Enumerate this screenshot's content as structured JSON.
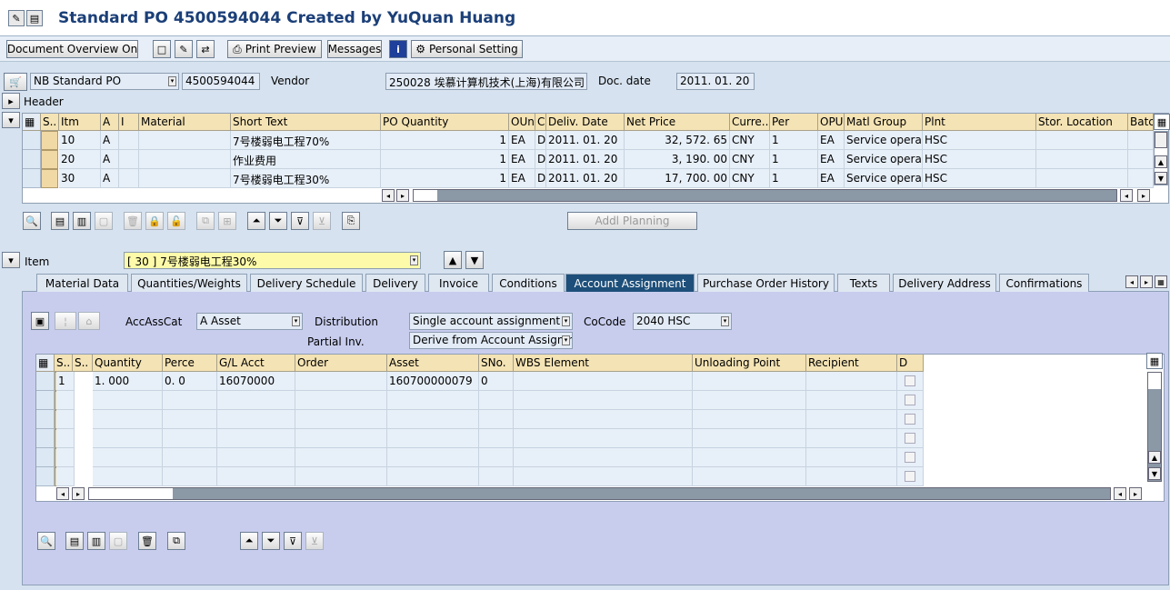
{
  "window": {
    "title": "Standard PO 4500594044 Created by YuQuan Huang"
  },
  "toolbar": {
    "doc_overview": "Document Overview On",
    "print_preview": "Print Preview",
    "messages": "Messages",
    "personal_setting": "Personal Setting"
  },
  "header": {
    "doc_type": "NB Standard PO",
    "po_number": "4500594044",
    "vendor_label": "Vendor",
    "vendor_value": "250028 埃慕计算机技术(上海)有限公司",
    "docdate_label": "Doc. date",
    "docdate_value": "2011. 01. 20",
    "header_label": "Header"
  },
  "items_table": {
    "columns": [
      "S..",
      "Itm",
      "A",
      "I",
      "Material",
      "Short Text",
      "PO Quantity",
      "OUn",
      "C",
      "Deliv. Date",
      "Net Price",
      "Curre...",
      "Per",
      "OPU",
      "Matl Group",
      "Plnt",
      "Stor. Location",
      "Batch"
    ],
    "rows": [
      {
        "itm": "10",
        "a": "A",
        "short": "7号楼弱电工程70%",
        "qty": "1",
        "oun": "EA",
        "c": "D",
        "date": "2011. 01. 20",
        "price": "32, 572. 65",
        "cur": "CNY",
        "per": "1",
        "opu": "EA",
        "matl": "Service operatio",
        "plnt": "HSC"
      },
      {
        "itm": "20",
        "a": "A",
        "short": "作业费用",
        "qty": "1",
        "oun": "EA",
        "c": "D",
        "date": "2011. 01. 20",
        "price": "3, 190. 00",
        "cur": "CNY",
        "per": "1",
        "opu": "EA",
        "matl": "Service operatio",
        "plnt": "HSC"
      },
      {
        "itm": "30",
        "a": "A",
        "short": "7号楼弱电工程30%",
        "qty": "1",
        "oun": "EA",
        "c": "D",
        "date": "2011. 01. 20",
        "price": "17, 700. 00",
        "cur": "CNY",
        "per": "1",
        "opu": "EA",
        "matl": "Service operatio",
        "plnt": "HSC"
      }
    ]
  },
  "addl_planning": "Addl Planning",
  "item": {
    "label": "Item",
    "value": "[ 30 ] 7号楼弱电工程30%"
  },
  "tabs": [
    "Material Data",
    "Quantities/Weights",
    "Delivery Schedule",
    "Delivery",
    "Invoice",
    "Conditions",
    "Account Assignment",
    "Purchase Order History",
    "Texts",
    "Delivery Address",
    "Confirmations"
  ],
  "acct": {
    "accasscat_label": "AccAssCat",
    "accasscat_value": "A Asset",
    "distribution_label": "Distribution",
    "distribution_value": "Single account assignment",
    "cocode_label": "CoCode",
    "cocode_value": "2040 HSC",
    "partial_label": "Partial Inv.",
    "partial_value": "Derive from Account Assignm"
  },
  "acct_table": {
    "columns": [
      "S..",
      "S..",
      "Quantity",
      "Perce",
      "G/L Acct",
      "Order",
      "Asset",
      "SNo.",
      "WBS Element",
      "Unloading Point",
      "Recipient",
      "D"
    ],
    "row": {
      "s": "1",
      "qty": "1. 000",
      "perc": "0. 0",
      "gl": "16070000",
      "asset": "160700000079",
      "sno": "0"
    }
  }
}
